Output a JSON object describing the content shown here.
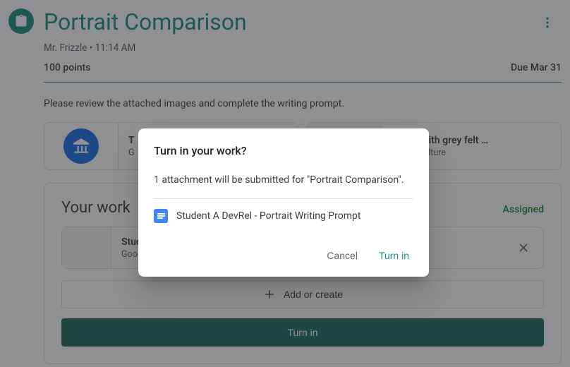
{
  "assignment": {
    "title": "Portrait Comparison",
    "teacher": "Mr. Frizzle",
    "timestamp": "11:14 AM",
    "points": "100 points",
    "due": "Due Mar 31",
    "description": "Please review the attached images and complete the writing prompt."
  },
  "attachments": [
    {
      "title_visible": "T",
      "source_visible": "G"
    },
    {
      "title_visible": "ortrait with grey felt …",
      "source_visible": "Arts & Culture"
    }
  ],
  "work": {
    "section_title": "Your work",
    "status": "Assigned",
    "file": {
      "name_visible": "Studer",
      "type_visible": "Google"
    },
    "add_label": "Add or create",
    "turnin_label": "Turn in"
  },
  "dialog": {
    "title": "Turn in your work?",
    "body": "1 attachment will be submitted for \"Portrait Comparison\".",
    "filename": "Student A DevRel - Portrait Writing Prompt",
    "cancel": "Cancel",
    "confirm": "Turn in"
  }
}
